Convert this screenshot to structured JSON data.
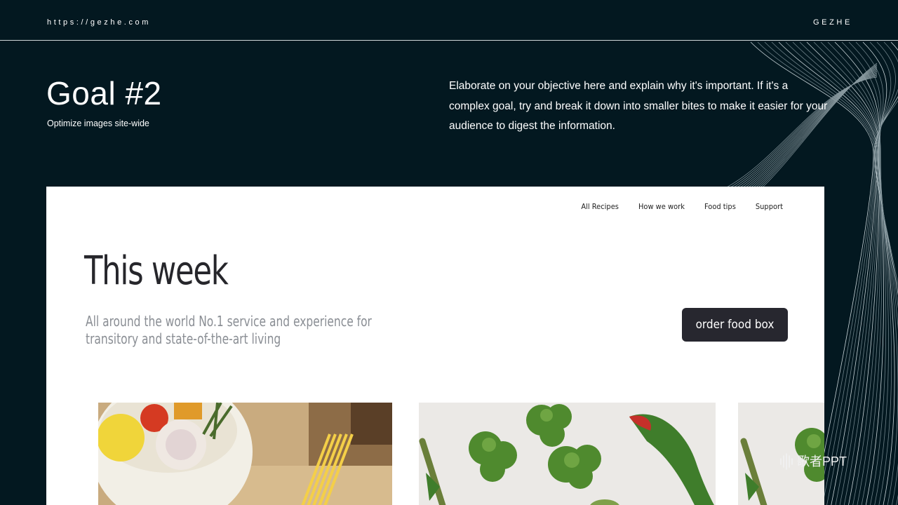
{
  "header": {
    "url": "https://gezhe.com",
    "brand": "GEZHE"
  },
  "goal": {
    "title": "Goal #2",
    "subtitle": "Optimize images site-wide",
    "description": "Elaborate on your objective here and explain why it's important. If it's a complex goal, try and break it down into smaller bites to make it easier  for your audience to digest the information."
  },
  "website": {
    "nav": [
      "All  Recipes",
      "How we work",
      "Food tips",
      "Support"
    ],
    "title": "This week",
    "tagline": "All around the world No.1  service and experience for transitory and state-of-the-art living",
    "button_label": "order food box",
    "photos": [
      "pasta-ingredients-photo",
      "broccoli-vegetables-photo",
      "broccoli-vegetables-photo"
    ]
  },
  "watermark": {
    "text": "歌者PPT"
  },
  "colors": {
    "background": "#031820",
    "card": "#ffffff",
    "button": "#27272f",
    "tagline": "#8a8e94"
  }
}
